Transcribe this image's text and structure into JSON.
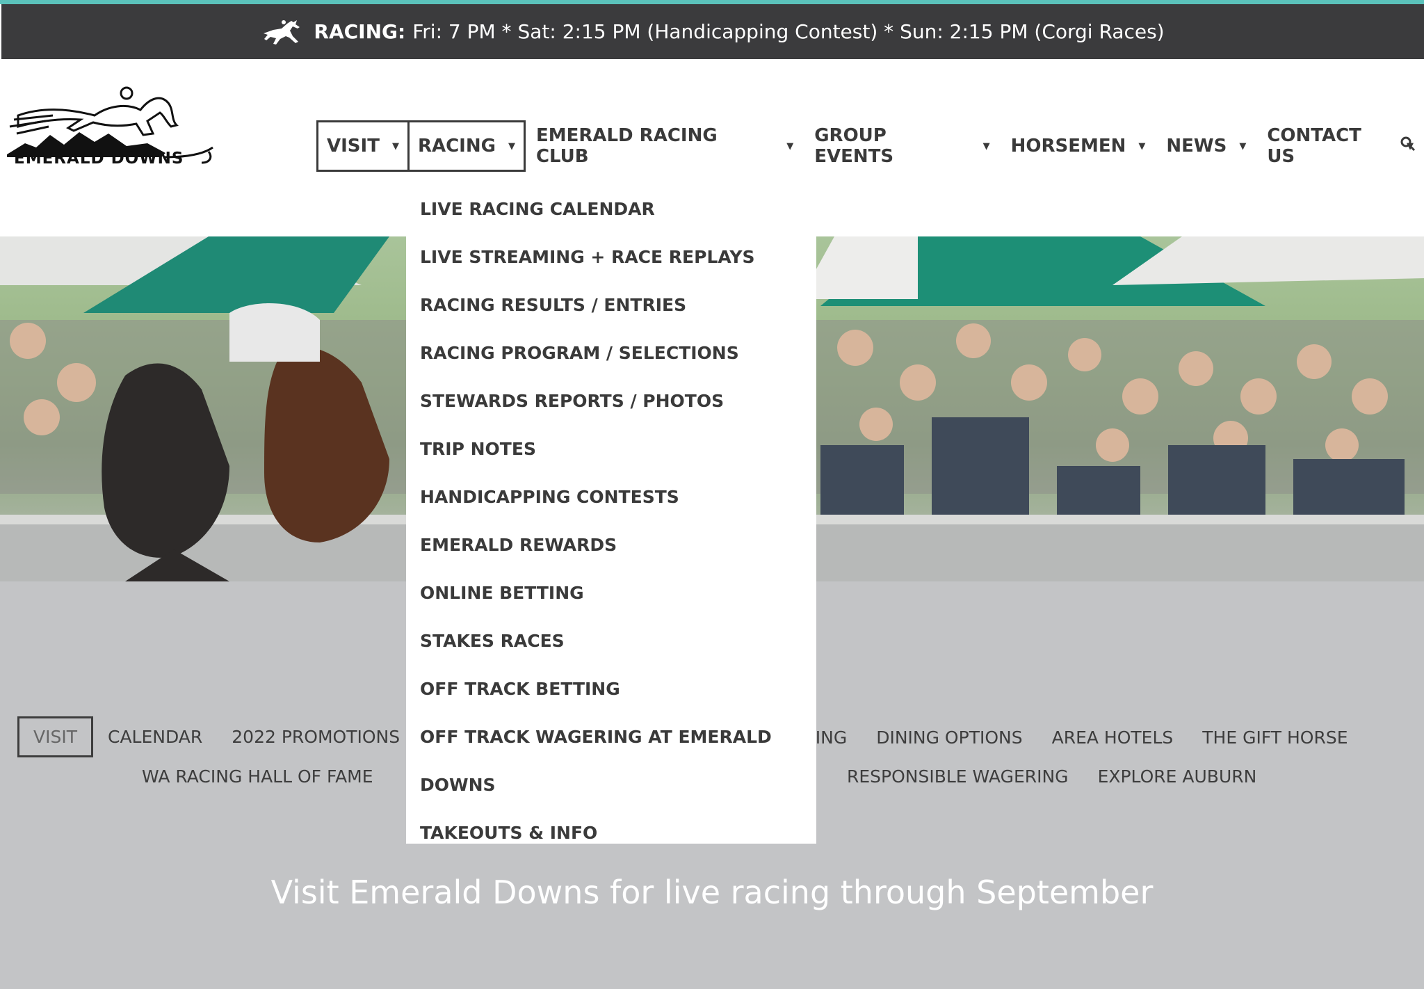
{
  "announcement": {
    "label": "RACING:",
    "message": "Fri: 7 PM * Sat: 2:15 PM (Handicapping Contest) * Sun: 2:15 PM (Corgi Races)",
    "icon": "racehorse-icon"
  },
  "logo": {
    "text": "EMERALD DOWNS"
  },
  "nav": {
    "items": [
      {
        "label": "VISIT"
      },
      {
        "label": "RACING"
      },
      {
        "label": "EMERALD RACING CLUB"
      },
      {
        "label": "GROUP EVENTS"
      },
      {
        "label": "HORSEMEN"
      },
      {
        "label": "NEWS"
      },
      {
        "label": "CONTACT US"
      }
    ],
    "search_icon": "search-icon"
  },
  "racing_menu": {
    "items": [
      {
        "label": "LIVE RACING CALENDAR"
      },
      {
        "label": "LIVE STREAMING + RACE REPLAYS"
      },
      {
        "label": "RACING RESULTS / ENTRIES"
      },
      {
        "label": "RACING PROGRAM / SELECTIONS"
      },
      {
        "label": "STEWARDS REPORTS / PHOTOS"
      },
      {
        "label": "TRIP NOTES"
      },
      {
        "label": "HANDICAPPING CONTESTS"
      },
      {
        "label": "EMERALD REWARDS"
      },
      {
        "label": "ONLINE BETTING"
      },
      {
        "label": "STAKES RACES"
      },
      {
        "label": "OFF TRACK BETTING"
      },
      {
        "label": "OFF TRACK WAGERING AT EMERALD"
      },
      {
        "label": "DOWNS"
      },
      {
        "label": "TAKEOUTS & INFO"
      }
    ]
  },
  "subnav": {
    "row1_left": [
      "VISIT",
      "CALENDAR",
      "2022 PROMOTIONS"
    ],
    "row1_right": [
      "RKING",
      "DINING OPTIONS",
      "AREA HOTELS",
      "THE GIFT HORSE"
    ],
    "row2_left": [
      "WA RACING HALL OF FAME"
    ],
    "row2_right": [
      "RESPONSIBLE WAGERING",
      "EXPLORE AUBURN"
    ]
  },
  "tagline": "Visit Emerald Downs for live racing through September",
  "colors": {
    "accent": "#5bc2bb",
    "bar": "#3b3b3d",
    "band": "#c3c4c6"
  }
}
